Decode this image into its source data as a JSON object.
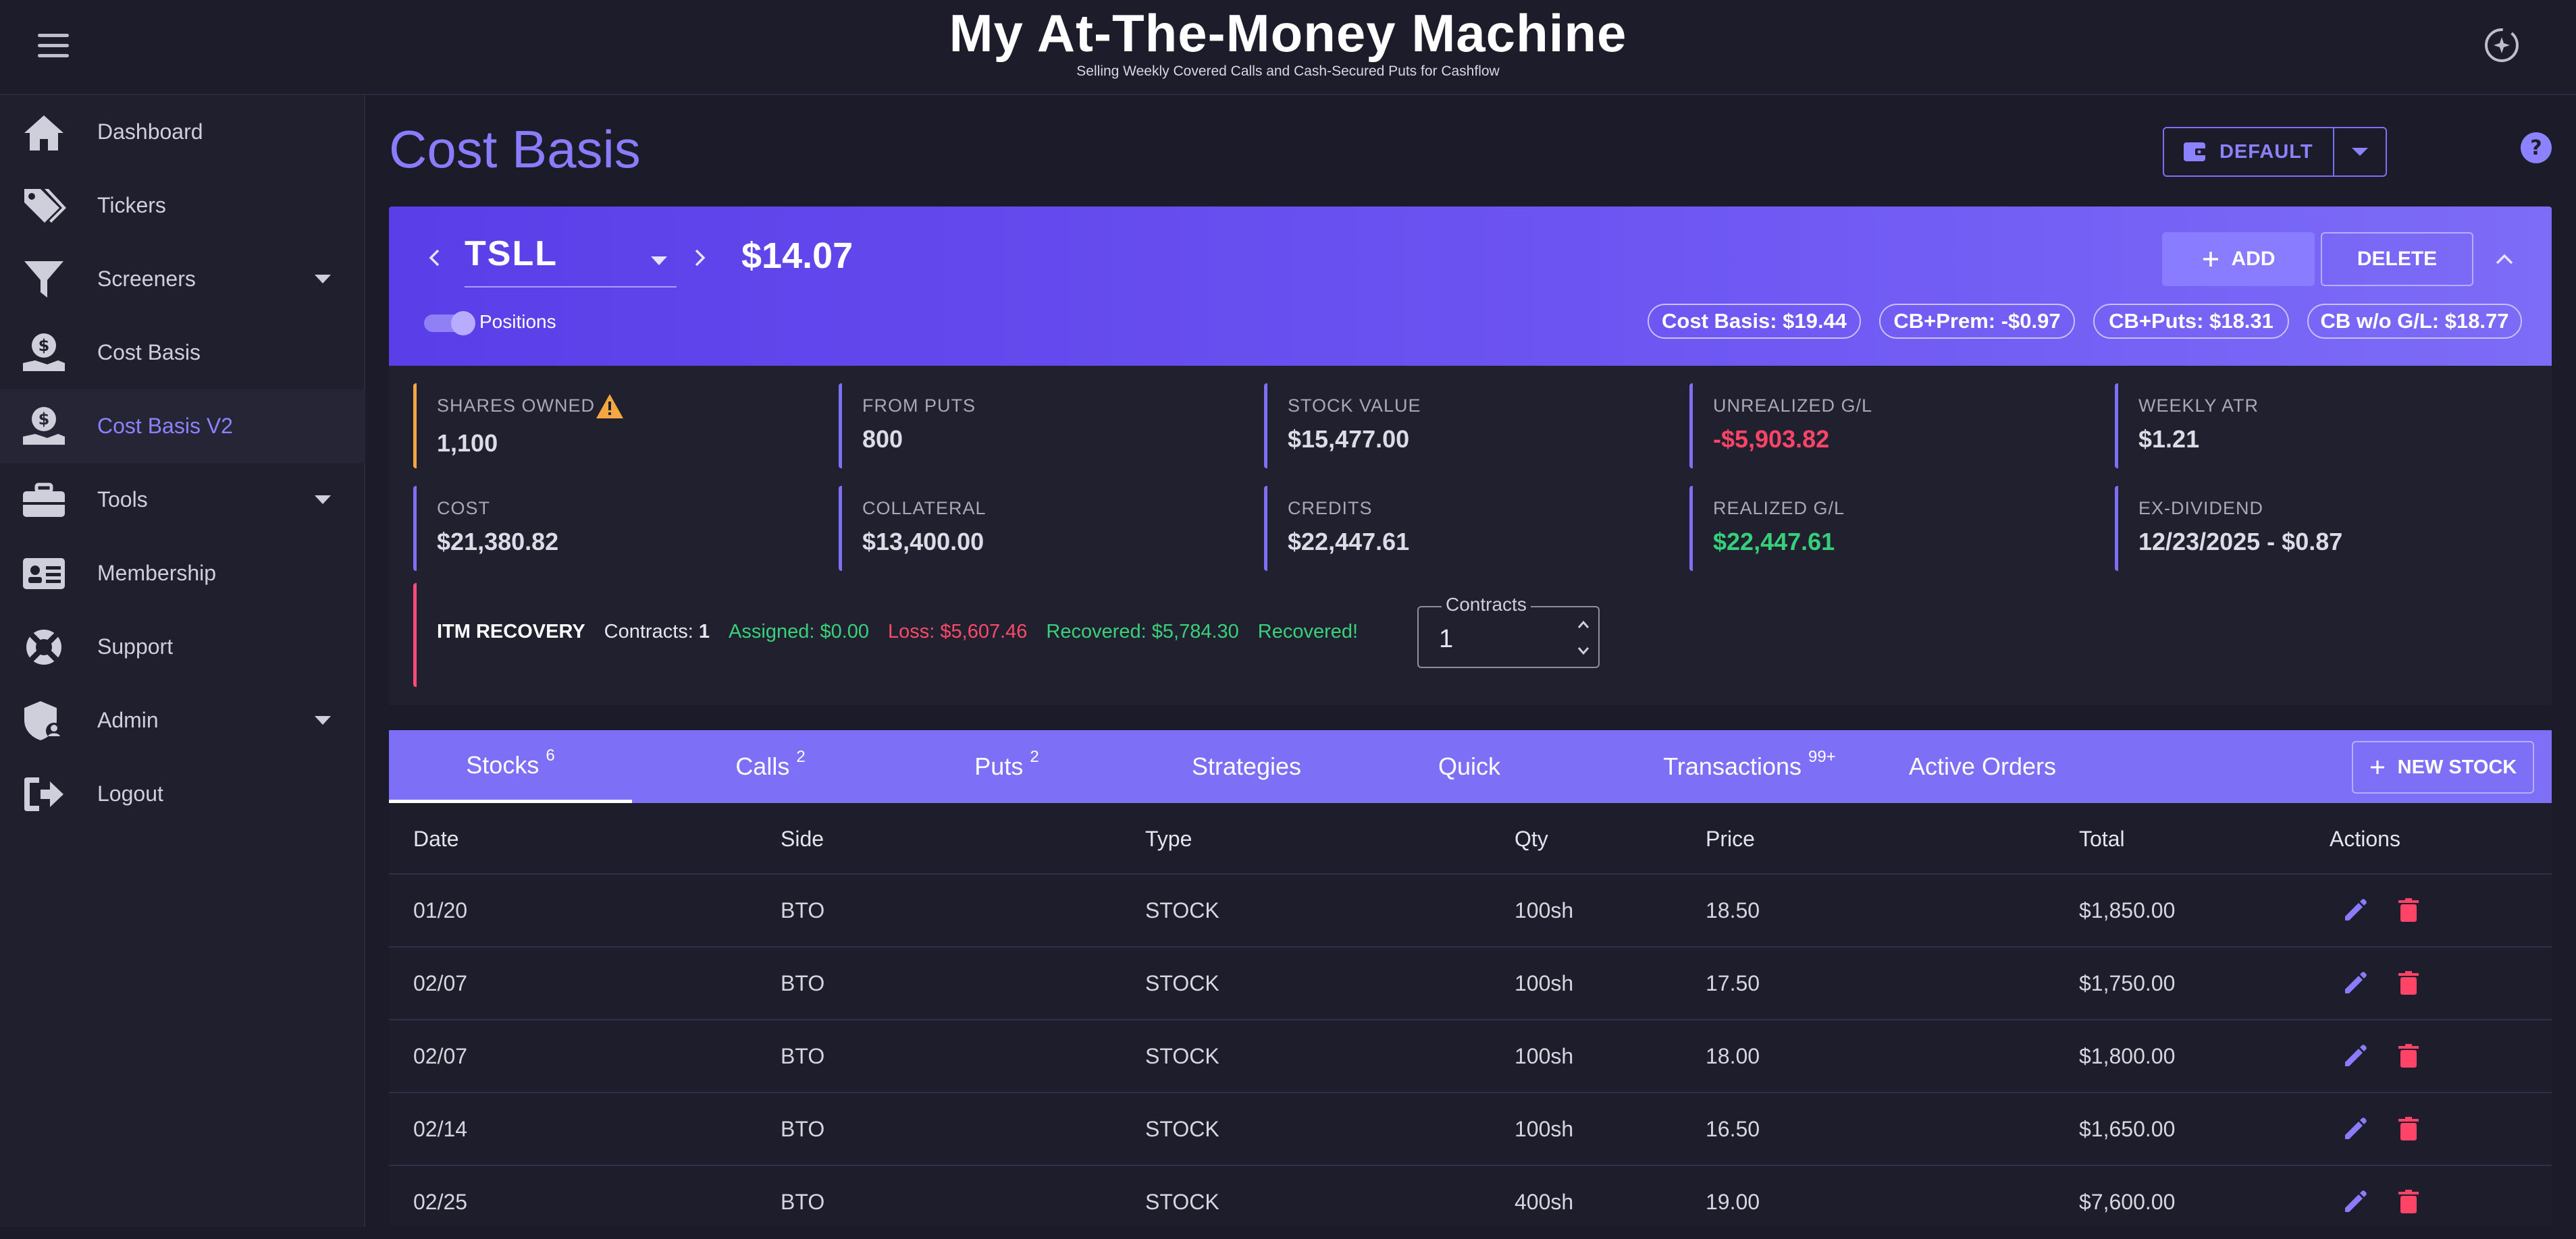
{
  "header": {
    "title": "My At-The-Money Machine",
    "subtitle": "Selling Weekly Covered Calls and Cash-Secured Puts for Cashflow"
  },
  "sidebar": {
    "items": [
      {
        "label": "Dashboard",
        "icon": "home-icon"
      },
      {
        "label": "Tickers",
        "icon": "tags-icon"
      },
      {
        "label": "Screeners",
        "icon": "filter-icon",
        "expandable": true
      },
      {
        "label": "Cost Basis",
        "icon": "money-hand-icon"
      },
      {
        "label": "Cost Basis V2",
        "icon": "money-hand-icon",
        "active": true
      },
      {
        "label": "Tools",
        "icon": "toolbox-icon",
        "expandable": true
      },
      {
        "label": "Membership",
        "icon": "id-card-icon"
      },
      {
        "label": "Support",
        "icon": "lifebuoy-icon"
      },
      {
        "label": "Admin",
        "icon": "shield-user-icon",
        "expandable": true
      },
      {
        "label": "Logout",
        "icon": "logout-icon"
      }
    ]
  },
  "page": {
    "title": "Cost Basis",
    "portfolio_label": "DEFAULT"
  },
  "ticker": {
    "symbol": "TSLL",
    "price": "$14.07",
    "toggle_label": "Positions",
    "toggle_on": true,
    "add_label": "ADD",
    "delete_label": "DELETE",
    "chips": [
      "Cost Basis: $19.44",
      "CB+Prem: -$0.97",
      "CB+Puts: $18.31",
      "CB w/o G/L: $18.77"
    ]
  },
  "stats": {
    "shares_owned": {
      "label": "SHARES OWNED",
      "value": "1,100"
    },
    "from_puts": {
      "label": "FROM PUTS",
      "value": "800"
    },
    "stock_value": {
      "label": "STOCK VALUE",
      "value": "$15,477.00"
    },
    "unrealized": {
      "label": "UNREALIZED G/L",
      "value": "-$5,903.82"
    },
    "weekly_atr": {
      "label": "WEEKLY ATR",
      "value": "$1.21"
    },
    "cost": {
      "label": "COST",
      "value": "$21,380.82"
    },
    "collateral": {
      "label": "COLLATERAL",
      "value": "$13,400.00"
    },
    "credits": {
      "label": "CREDITS",
      "value": "$22,447.61"
    },
    "realized": {
      "label": "REALIZED G/L",
      "value": "$22,447.61"
    },
    "ex_dividend": {
      "label": "EX-DIVIDEND",
      "value": "12/23/2025 - $0.87"
    }
  },
  "itm": {
    "title": "ITM RECOVERY",
    "contracts_prefix": "Contracts:",
    "contracts_count": "1",
    "assigned": "Assigned: $0.00",
    "loss": "Loss: $5,607.46",
    "recovered_amount": "Recovered: $5,784.30",
    "recovered_status": "Recovered!",
    "field_label": "Contracts",
    "field_value": "1"
  },
  "tabs": [
    {
      "label": "Stocks",
      "badge": "6",
      "active": true
    },
    {
      "label": "Calls",
      "badge": "2"
    },
    {
      "label": "Puts",
      "badge": "2"
    },
    {
      "label": "Strategies",
      "badge": ""
    },
    {
      "label": "Quick",
      "badge": ""
    },
    {
      "label": "Transactions",
      "badge": "99+"
    },
    {
      "label": "Active Orders",
      "badge": ""
    }
  ],
  "new_stock_label": "NEW STOCK",
  "table": {
    "columns": [
      "Date",
      "Side",
      "Type",
      "Qty",
      "Price",
      "Total",
      "Actions"
    ],
    "rows": [
      {
        "date": "01/20",
        "side": "BTO",
        "type": "STOCK",
        "qty": "100sh",
        "price": "18.50",
        "total": "$1,850.00"
      },
      {
        "date": "02/07",
        "side": "BTO",
        "type": "STOCK",
        "qty": "100sh",
        "price": "17.50",
        "total": "$1,750.00"
      },
      {
        "date": "02/07",
        "side": "BTO",
        "type": "STOCK",
        "qty": "100sh",
        "price": "18.00",
        "total": "$1,800.00"
      },
      {
        "date": "02/14",
        "side": "BTO",
        "type": "STOCK",
        "qty": "100sh",
        "price": "16.50",
        "total": "$1,650.00"
      },
      {
        "date": "02/25",
        "side": "BTO",
        "type": "STOCK",
        "qty": "400sh",
        "price": "19.00",
        "total": "$7,600.00"
      }
    ]
  },
  "colors": {
    "accent": "#7e6ff7",
    "negative": "#ff4468",
    "positive": "#35d17a",
    "warning": "#f5a742",
    "background": "#1b1b2a"
  }
}
